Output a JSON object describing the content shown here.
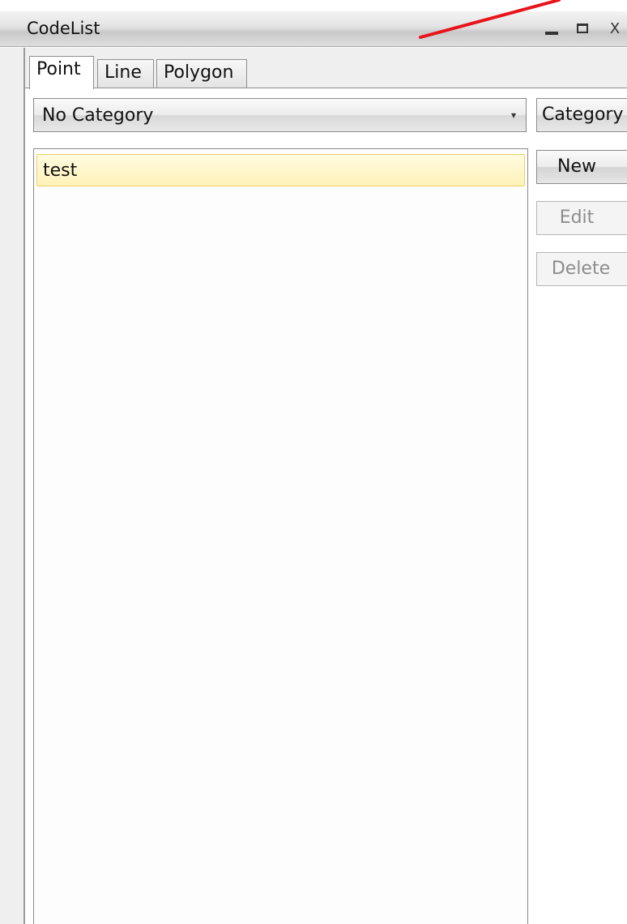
{
  "window": {
    "title": "CodeList",
    "close_glyph": "X"
  },
  "tabs": [
    {
      "label": "Point",
      "active": true
    },
    {
      "label": "Line",
      "active": false
    },
    {
      "label": "Polygon",
      "active": false
    }
  ],
  "category_select": {
    "selected": "No Category",
    "arrow": "▾"
  },
  "buttons": {
    "category": "Category",
    "new": "New",
    "edit": "Edit",
    "delete": "Delete"
  },
  "list": {
    "items": [
      {
        "label": "test",
        "selected": true
      }
    ]
  },
  "colors": {
    "annotation_red": "#e8141b",
    "selection_fill": "#fff5c4",
    "selection_border": "#f0cf6a",
    "disabled_text": "#8c8c8c"
  },
  "icons": [
    "minimize-icon",
    "maximize-icon",
    "close-icon",
    "dropdown-arrow-icon"
  ]
}
